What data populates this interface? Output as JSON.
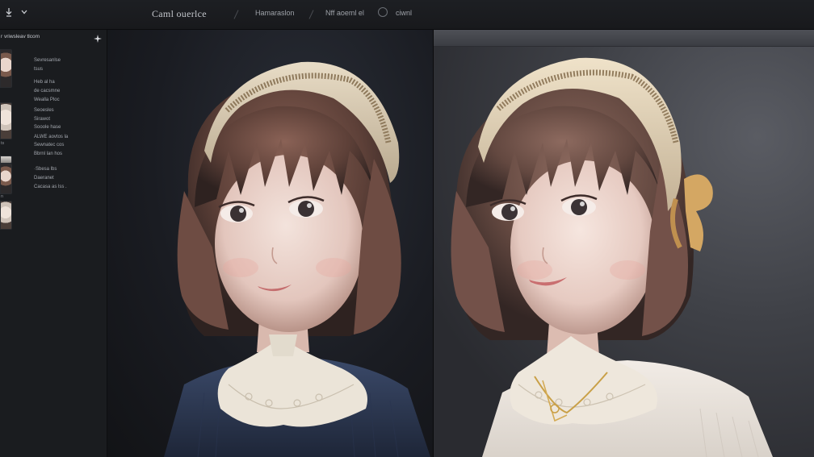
{
  "toolbar": {
    "title": "Caml ouerlce",
    "item1": "Hamaraslon",
    "item2": "Nff aoeml el",
    "item3": "ciwnl",
    "icons": [
      "download-icon",
      "chevron-down-icon"
    ]
  },
  "sidebar": {
    "header": "r vriwsleav tlcom",
    "lines": [
      "Sevresanlse",
      "tsus",
      "Heb al ha",
      "de cacsmne",
      "Wealla Ploc",
      "Seoesles",
      "Sirawot",
      "Sooole hase",
      "ALWE aovtos la",
      "Sewnatec cos",
      "Bbrnl lan hos",
      "·Sbesa lbs",
      "Daeranet",
      "Cacasa as lss ."
    ],
    "side_marks": [
      "ts",
      "n"
    ]
  },
  "colors": {
    "app_bg": "#141518",
    "topbar_bg": "#1d1f23",
    "sidebar_bg": "#1a1c1f",
    "left_panel_bg": "#1e2128",
    "right_panel_bg": "#44464c"
  }
}
